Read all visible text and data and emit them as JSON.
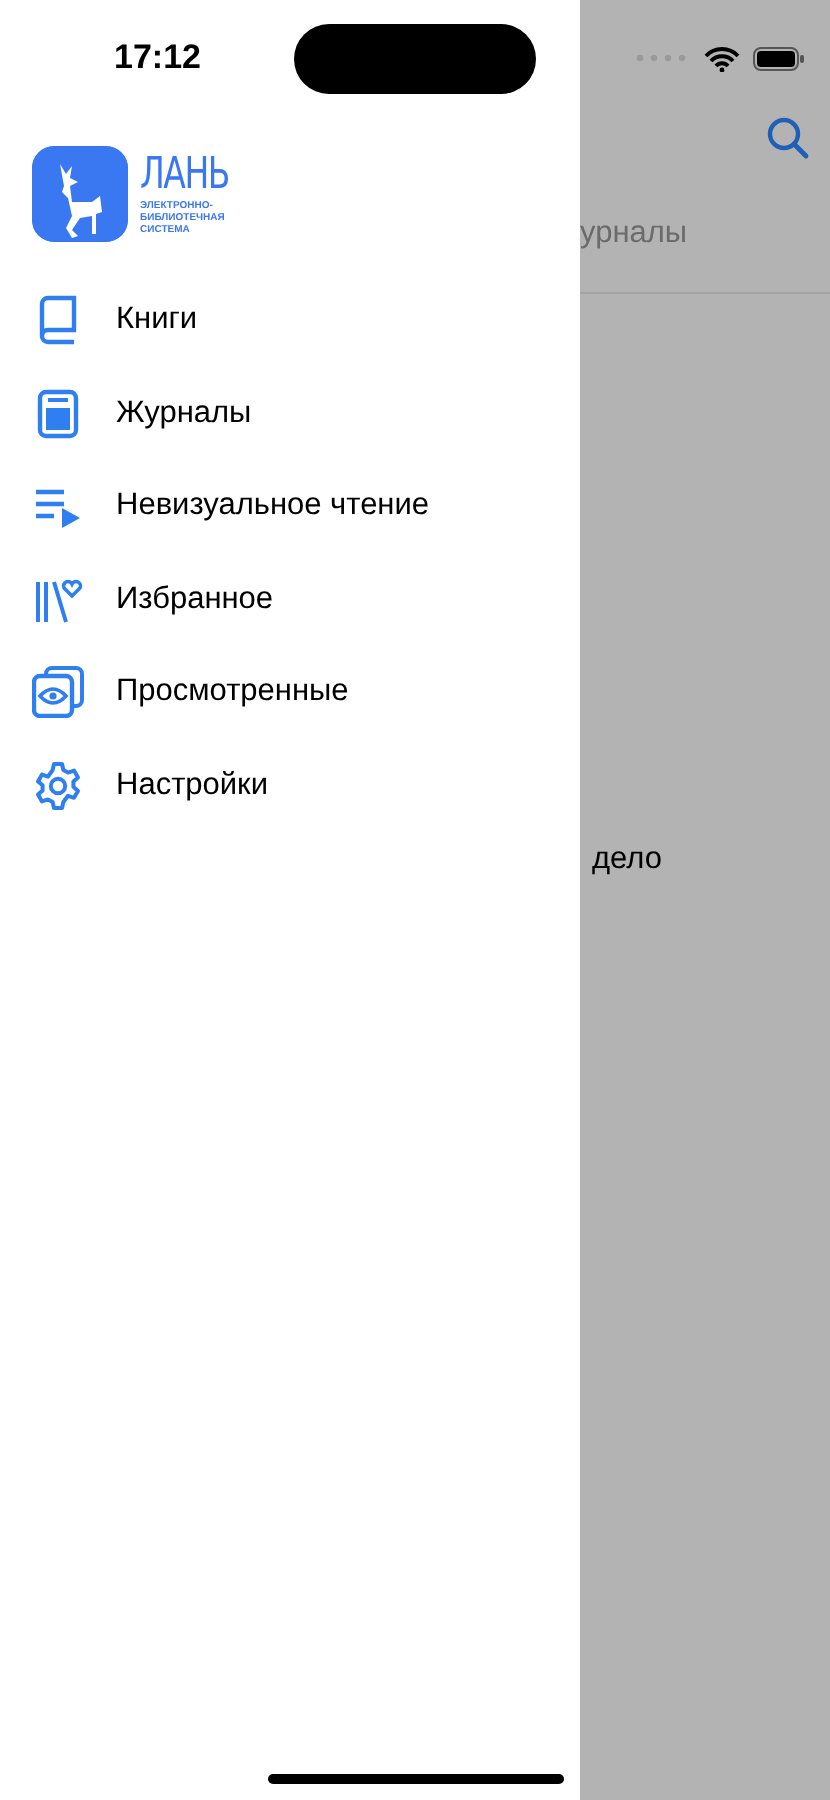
{
  "status_bar": {
    "time": "17:12"
  },
  "logo": {
    "title": "ЛАНЬ",
    "subtitle": [
      "ЭЛЕКТРОННО-",
      "БИБЛИОТЕЧНАЯ",
      "СИСТЕМА"
    ]
  },
  "menu": [
    {
      "label": "Книги"
    },
    {
      "label": "Журналы"
    },
    {
      "label": "Невизуальное чтение"
    },
    {
      "label": "Избранное"
    },
    {
      "label": "Просмотренные"
    },
    {
      "label": "Настройки"
    }
  ],
  "background": {
    "tab": "урналы",
    "text": "дело"
  }
}
